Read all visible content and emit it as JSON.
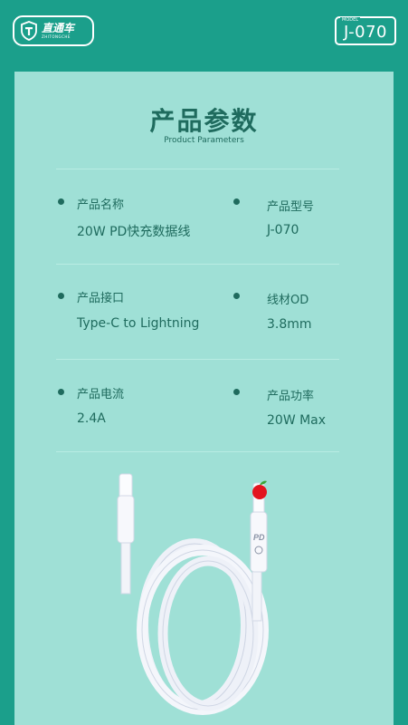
{
  "brand": {
    "name_cn": "直通车",
    "name_en": "ZHITONGCHE"
  },
  "model": {
    "label": "MODEL",
    "value": "J-070"
  },
  "title": "产品参数",
  "subtitle": "Product Parameters",
  "specs": [
    {
      "label": "产品名称",
      "value": "20W PD快充数据线"
    },
    {
      "label": "产品型号",
      "value": "J-070"
    },
    {
      "label": "产品接口",
      "value": "Type-C to Lightning"
    },
    {
      "label": "线材OD",
      "value": "3.8mm"
    },
    {
      "label": "产品电流",
      "value": "2.4A"
    },
    {
      "label": "产品功率",
      "value": "20W Max"
    }
  ],
  "connector_mark": "PD",
  "colors": {
    "background": "#1b9f8b",
    "panel": "#9fe0d6",
    "text": "#1f6b5e",
    "cable": "#f4f6fb"
  }
}
